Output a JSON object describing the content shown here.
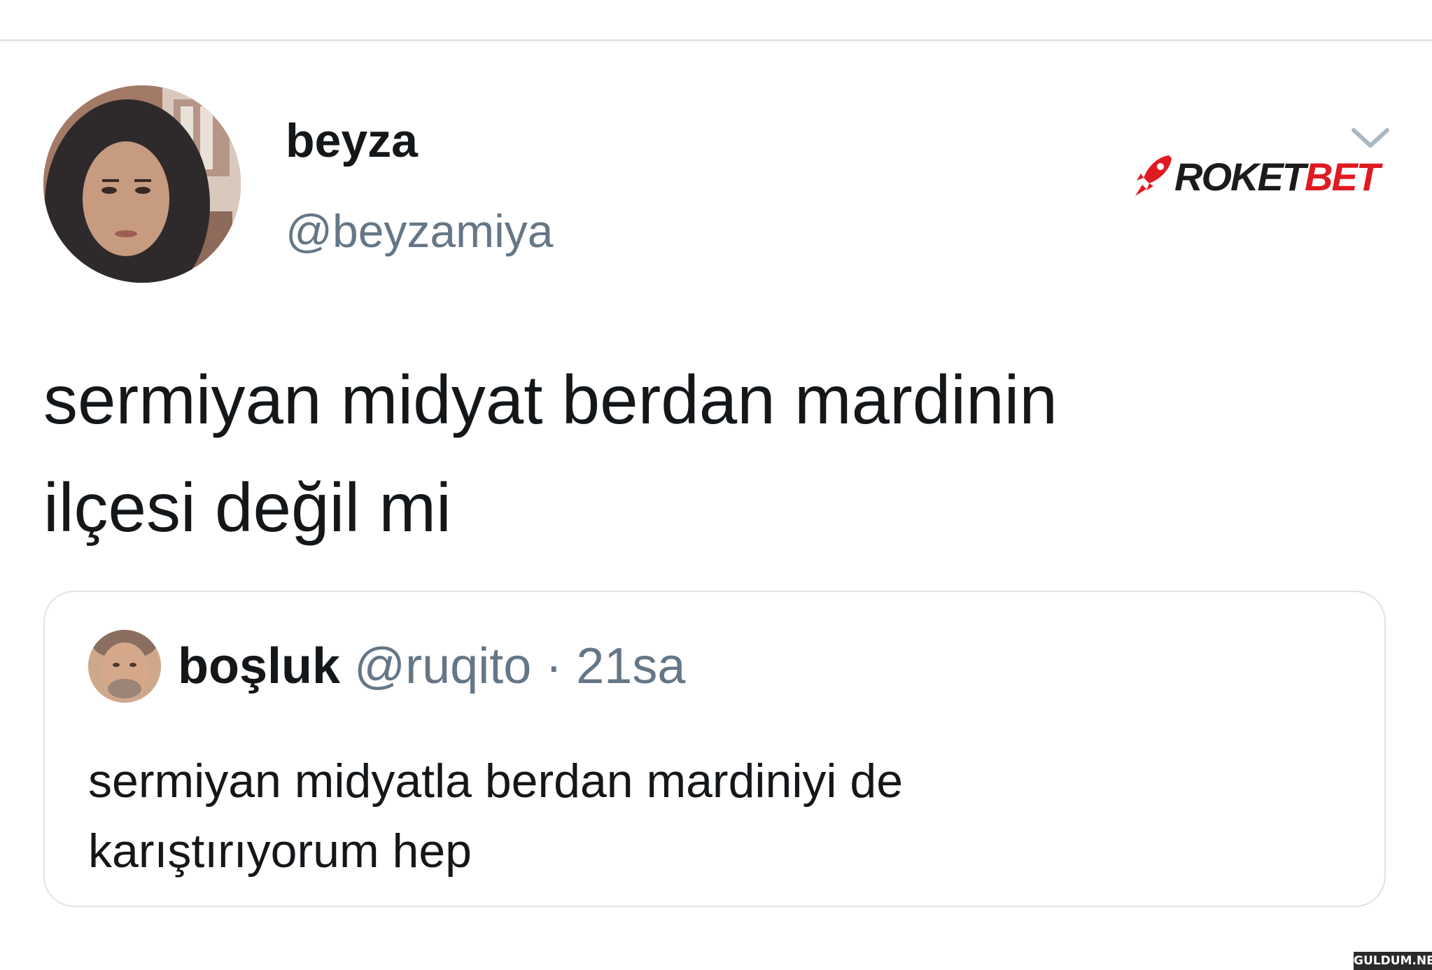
{
  "tweet": {
    "display_name": "beyza",
    "handle": "@beyzamiya",
    "text_line1": "sermiyan midyat berdan mardinin",
    "text_line2": "ilçesi değil mi",
    "avatar": "profile-photo",
    "menu_icon": "chevron-down-icon"
  },
  "quoted_tweet": {
    "display_name": "boşluk",
    "handle": "@ruqito",
    "separator": " · ",
    "time": "21sa",
    "text_line1": "sermiyan midyatla berdan mardiniyi de",
    "text_line2": "karıştırıyorum hep",
    "avatar": "profile-photo"
  },
  "overlay": {
    "logo_part1": "ROKET",
    "logo_part2": "BET",
    "logo_icon": "rocket-icon",
    "watermark": "GULDUM.NET"
  },
  "colors": {
    "text": "#14171a",
    "secondary": "#657786",
    "border": "#dfe3e6",
    "logo_red": "#e01a22"
  }
}
